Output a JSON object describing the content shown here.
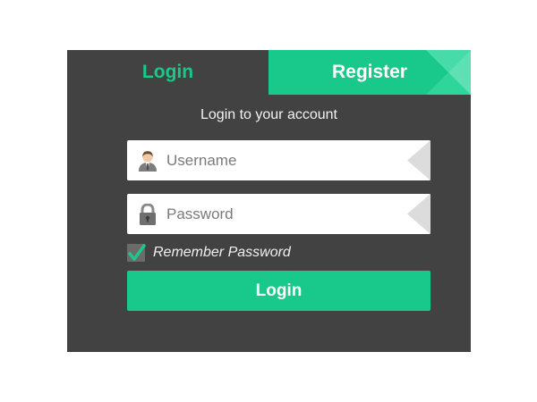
{
  "tabs": {
    "login_label": "Login",
    "register_label": "Register"
  },
  "form": {
    "subtitle": "Login to your account",
    "username": {
      "placeholder": "Username",
      "value": "",
      "icon": "user-icon"
    },
    "password": {
      "placeholder": "Password",
      "value": "",
      "icon": "lock-icon"
    },
    "remember": {
      "label": "Remember Password",
      "checked": true
    },
    "submit_label": "Login"
  },
  "colors": {
    "accent": "#18c98b",
    "panel": "#424242",
    "field": "#ffffff",
    "checkbox": "#6b6b6b"
  }
}
